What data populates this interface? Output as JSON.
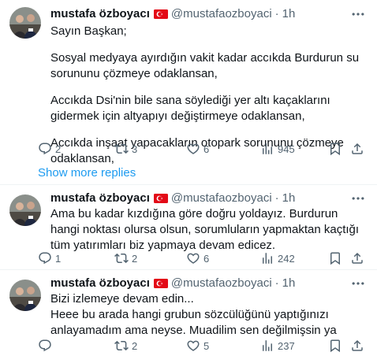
{
  "tweets": [
    {
      "author_name": "mustafa özboyacı",
      "handle": "@mustafaozboyaci",
      "separator": "·",
      "time": "1h",
      "paragraphs": [
        "Sayın Başkan;",
        "Sosyal medyaya ayırdığın vakit kadar accıkda Burdurun su sorununu çözmeye odaklansan,",
        "Accıkda Dsi'nin bile sana söylediği yer altı kaçaklarını gidermek için altyapıyı değiştirmeye odaklansan,",
        "Accıkda inşaat yapacakların otopark sorununu çözmeye odaklansan,"
      ],
      "replies": "2",
      "reposts": "3",
      "likes": "6",
      "views": "945"
    },
    {
      "author_name": "mustafa özboyacı",
      "handle": "@mustafaozboyaci",
      "separator": "·",
      "time": "1h",
      "paragraphs": [
        "Ama bu kadar kızdığına göre doğru yoldayız. Burdurun hangi noktası olursa olsun, sorumluların yapmaktan kaçtığı tüm yatırımları biz yapmaya devam edicez."
      ],
      "replies": "1",
      "reposts": "2",
      "likes": "6",
      "views": "242"
    },
    {
      "author_name": "mustafa özboyacı",
      "handle": "@mustafaozboyaci",
      "separator": "·",
      "time": "1h",
      "paragraphs": [
        "Bizi izlemeye devam edin...",
        "Heee bu arada hangi grubun sözcülüğünü yaptığınızı anlayamadım ama neyse. Muadilim sen değilmişsin ya"
      ],
      "replies": "",
      "reposts": "2",
      "likes": "5",
      "views": "237"
    }
  ],
  "show_more_replies": "Show more replies",
  "icons": {
    "flag": "turkey-flag-icon",
    "reply": "reply-icon",
    "repost": "repost-icon",
    "like": "like-icon",
    "views": "views-icon",
    "share": "share-icon",
    "more": "more-icon"
  },
  "colors": {
    "link": "#1d9bf0",
    "secondary_text": "#536471",
    "primary_text": "#0f1419",
    "flag_red": "#e30a17"
  }
}
